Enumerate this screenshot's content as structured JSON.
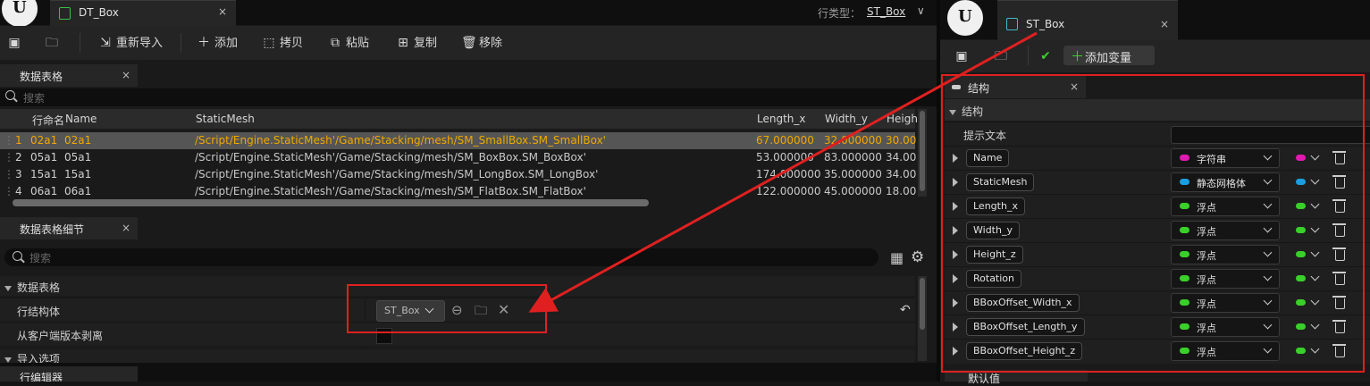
{
  "left": {
    "doc_tab": {
      "title": "DT_Box",
      "close": "×"
    },
    "row_type_label": "行类型：",
    "row_type_value": "ST_Box",
    "toolbar": {
      "reimport": "重新导入",
      "add": "添加",
      "copy": "拷贝",
      "paste": "粘贴",
      "duplicate": "复制",
      "remove": "移除"
    },
    "table_panel": {
      "tab": "数据表格",
      "close": "×",
      "search_placeholder": "搜索"
    },
    "columns": [
      "",
      "行命名",
      "Name",
      "StaticMesh",
      "Length_x",
      "Width_y",
      "Heigh"
    ],
    "rows": [
      {
        "idx": "1",
        "rowname": "02a1",
        "name": "02a1",
        "mesh": "/Script/Engine.StaticMesh'/Game/Stacking/mesh/SM_SmallBox.SM_SmallBox'",
        "length": "67.000000",
        "width": "32.000000",
        "height": "30.00"
      },
      {
        "idx": "2",
        "rowname": "05a1",
        "name": "05a1",
        "mesh": "/Script/Engine.StaticMesh'/Game/Stacking/mesh/SM_BoxBox.SM_BoxBox'",
        "length": "53.000000",
        "width": "83.000000",
        "height": "34.00"
      },
      {
        "idx": "3",
        "rowname": "15a1",
        "name": "15a1",
        "mesh": "/Script/Engine.StaticMesh'/Game/Stacking/mesh/SM_LongBox.SM_LongBox'",
        "length": "174.000000",
        "width": "35.000000",
        "height": "34.00"
      },
      {
        "idx": "4",
        "rowname": "06a1",
        "name": "06a1",
        "mesh": "/Script/Engine.StaticMesh'/Game/Stacking/mesh/SM_FlatBox.SM_FlatBox'",
        "length": "122.000000",
        "width": "45.000000",
        "height": "18.00"
      }
    ],
    "details_panel": {
      "tab": "数据表格细节",
      "close": "×",
      "search_placeholder": "搜索",
      "category": "数据表格",
      "row_struct_label": "行结构体",
      "row_struct_value": "ST_Box",
      "strip_label": "从客户端版本剥离",
      "import_category": "导入选项"
    },
    "row_editor_tab": "行编辑器"
  },
  "right": {
    "doc_tab": {
      "title": "ST_Box",
      "close": "×"
    },
    "add_variable": "添加变量",
    "struct_tab": {
      "title": "结构",
      "close": "×"
    },
    "category": "结构",
    "tooltip_label": "提示文本",
    "members": [
      {
        "name": "Name",
        "type": "字符串",
        "color": "#e01ab0"
      },
      {
        "name": "StaticMesh",
        "type": "静态网格体",
        "color": "#1a9ee0"
      },
      {
        "name": "Length_x",
        "type": "浮点",
        "color": "#3ad02a"
      },
      {
        "name": "Width_y",
        "type": "浮点",
        "color": "#3ad02a"
      },
      {
        "name": "Height_z",
        "type": "浮点",
        "color": "#3ad02a"
      },
      {
        "name": "Rotation",
        "type": "浮点",
        "color": "#3ad02a"
      },
      {
        "name": "BBoxOffset_Width_x",
        "type": "浮点",
        "color": "#3ad02a"
      },
      {
        "name": "BBoxOffset_Length_y",
        "type": "浮点",
        "color": "#3ad02a"
      },
      {
        "name": "BBoxOffset_Height_z",
        "type": "浮点",
        "color": "#3ad02a"
      }
    ],
    "default_tab": "默认值"
  },
  "colors": {
    "highlight_text": "#f0a800",
    "annotation": "#e02020",
    "selected_row": "#555555"
  }
}
